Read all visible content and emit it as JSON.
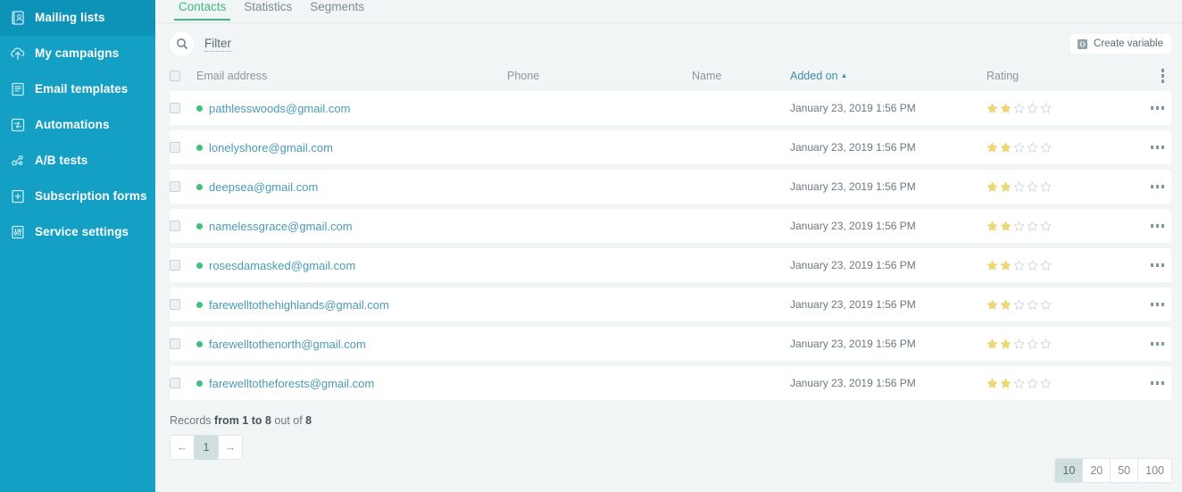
{
  "colors": {
    "sidebar_bg": "#13a0c4",
    "sidebar_active_bg": "#0e93b8",
    "accent_green": "#3fb883",
    "link_teal": "#4a9bb5",
    "status_dot": "#3fc07d",
    "star_filled": "#ead877",
    "page_bg": "#f2f5f6"
  },
  "sidebar": {
    "items": [
      {
        "label": "Mailing lists",
        "icon": "address-book-icon",
        "active": true
      },
      {
        "label": "My campaigns",
        "icon": "campaign-upload-icon",
        "active": false
      },
      {
        "label": "Email templates",
        "icon": "template-icon",
        "active": false
      },
      {
        "label": "Automations",
        "icon": "automation-flow-icon",
        "active": false
      },
      {
        "label": "A/B tests",
        "icon": "ab-test-icon",
        "active": false
      },
      {
        "label": "Subscription forms",
        "icon": "subscription-form-icon",
        "active": false
      },
      {
        "label": "Service settings",
        "icon": "sliders-icon",
        "active": false
      }
    ]
  },
  "tabs": [
    {
      "label": "Contacts",
      "active": true
    },
    {
      "label": "Statistics",
      "active": false
    },
    {
      "label": "Segments",
      "active": false
    }
  ],
  "toolbar": {
    "search_icon": "search-icon",
    "filter_label": "Filter",
    "create_variable_label": "Create variable",
    "create_variable_icon": "code-brackets-icon",
    "header_menu_icon": "vertical-kebab-icon"
  },
  "table": {
    "columns": [
      {
        "label": "Email address",
        "sorted": false
      },
      {
        "label": "Phone",
        "sorted": false
      },
      {
        "label": "Name",
        "sorted": false
      },
      {
        "label": "Added on",
        "sorted": true,
        "sort_dir": "asc",
        "sort_arrow": "▲"
      },
      {
        "label": "Rating",
        "sorted": false
      }
    ],
    "rows": [
      {
        "email": "pathlesswoods@gmail.com",
        "phone": "",
        "name": "",
        "added_on": "January 23, 2019 1:56 PM",
        "rating": 2,
        "status": "active"
      },
      {
        "email": "lonelyshore@gmail.com",
        "phone": "",
        "name": "",
        "added_on": "January 23, 2019 1:56 PM",
        "rating": 2,
        "status": "active"
      },
      {
        "email": "deepsea@gmail.com",
        "phone": "",
        "name": "",
        "added_on": "January 23, 2019 1:56 PM",
        "rating": 2,
        "status": "active"
      },
      {
        "email": "namelessgrace@gmail.com",
        "phone": "",
        "name": "",
        "added_on": "January 23, 2019 1:56 PM",
        "rating": 2,
        "status": "active"
      },
      {
        "email": "rosesdamasked@gmail.com",
        "phone": "",
        "name": "",
        "added_on": "January 23, 2019 1:56 PM",
        "rating": 2,
        "status": "active"
      },
      {
        "email": "farewelltothehighlands@gmail.com",
        "phone": "",
        "name": "",
        "added_on": "January 23, 2019 1:56 PM",
        "rating": 2,
        "status": "active"
      },
      {
        "email": "farewelltothenorth@gmail.com",
        "phone": "",
        "name": "",
        "added_on": "January 23, 2019 1:56 PM",
        "rating": 2,
        "status": "active"
      },
      {
        "email": "farewelltotheforests@gmail.com",
        "phone": "",
        "name": "",
        "added_on": "January 23, 2019 1:56 PM",
        "rating": 2,
        "status": "active"
      }
    ],
    "max_rating": 5,
    "row_menu_icon": "horizontal-kebab-icon"
  },
  "footer": {
    "records_prefix": "Records ",
    "records_range": "from 1 to 8",
    "records_middle": " out of ",
    "records_total": "8",
    "pagination": {
      "prev_label": "←",
      "next_label": "→",
      "pages": [
        "1"
      ],
      "current_page": "1"
    },
    "per_page": {
      "options": [
        "10",
        "20",
        "50",
        "100"
      ],
      "selected": "10"
    }
  }
}
